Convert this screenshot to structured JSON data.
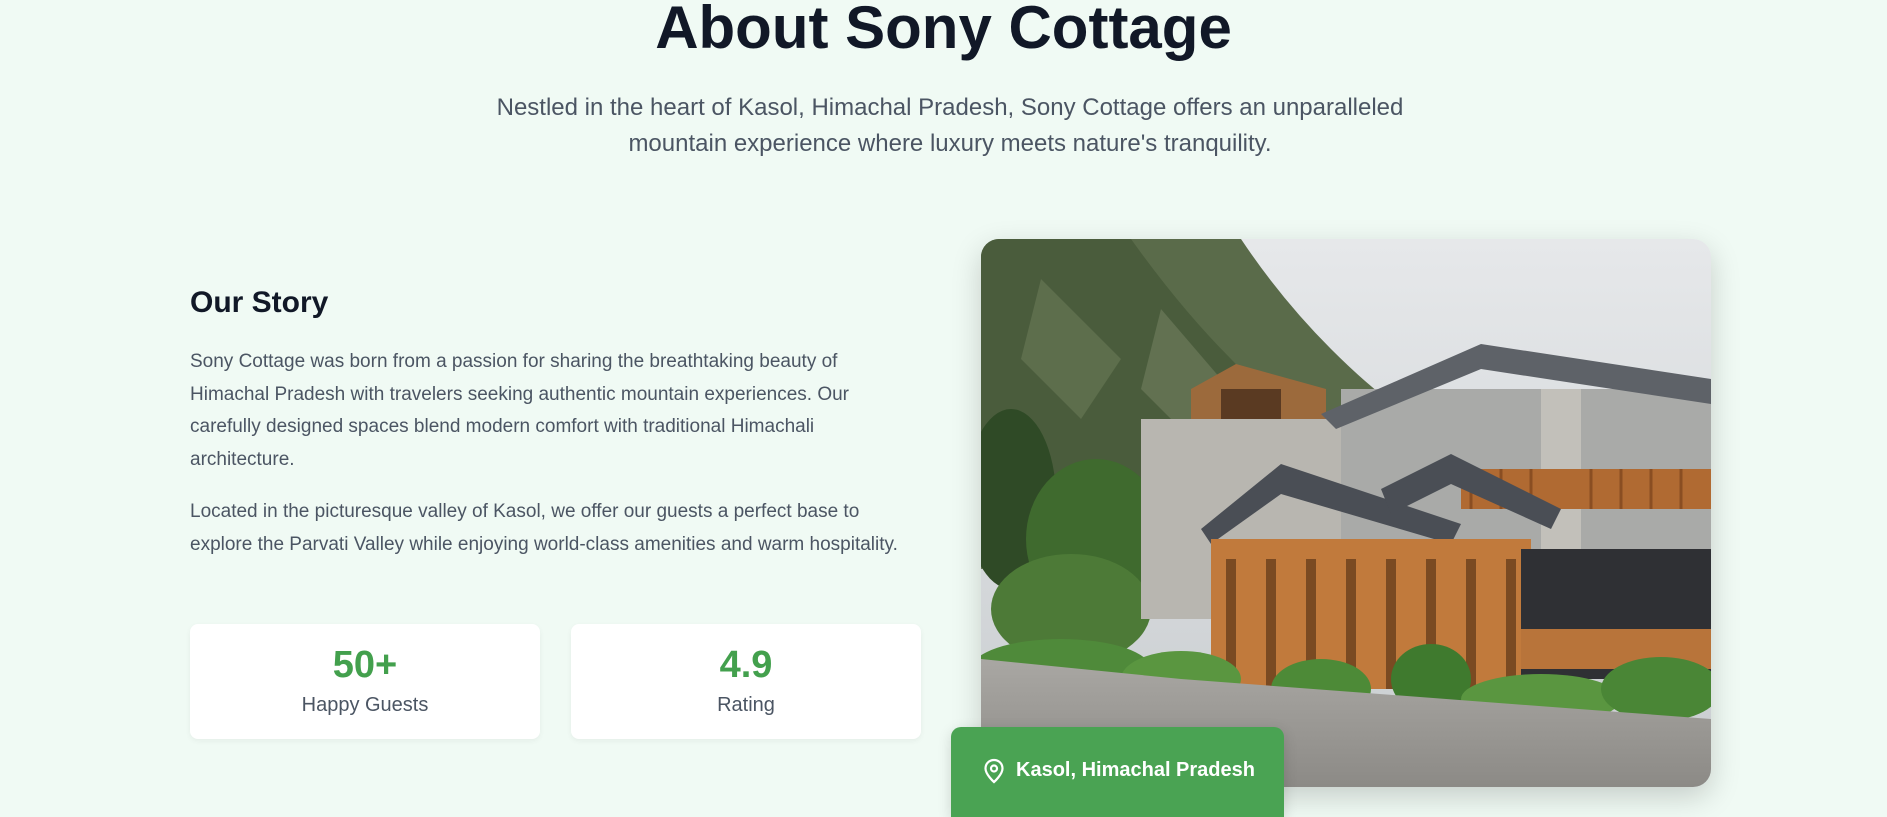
{
  "about": {
    "title": "About Sony Cottage",
    "subtitle": "Nestled in the heart of Kasol, Himachal Pradesh, Sony Cottage offers an unparalleled mountain experience where luxury meets nature's tranquility."
  },
  "story": {
    "heading": "Our Story",
    "paragraphs": [
      "Sony Cottage was born from a passion for sharing the breathtaking beauty of Himachal Pradesh with travelers seeking authentic mountain experiences. Our carefully designed spaces blend modern comfort with traditional Himachali architecture.",
      "Located in the picturesque valley of Kasol, we offer our guests a perfect base to explore the Parvati Valley while enjoying world-class amenities and warm hospitality."
    ]
  },
  "stats": [
    {
      "value": "50+",
      "label": "Happy Guests"
    },
    {
      "value": "4.9",
      "label": "Rating"
    }
  ],
  "location": {
    "icon": "map-pin-icon",
    "label": "Kasol, Himachal Pradesh"
  },
  "colors": {
    "background": "#f0faf4",
    "accent": "#43a04d",
    "badge": "#4aa353",
    "heading": "#111827",
    "body_text": "#4b5563"
  }
}
